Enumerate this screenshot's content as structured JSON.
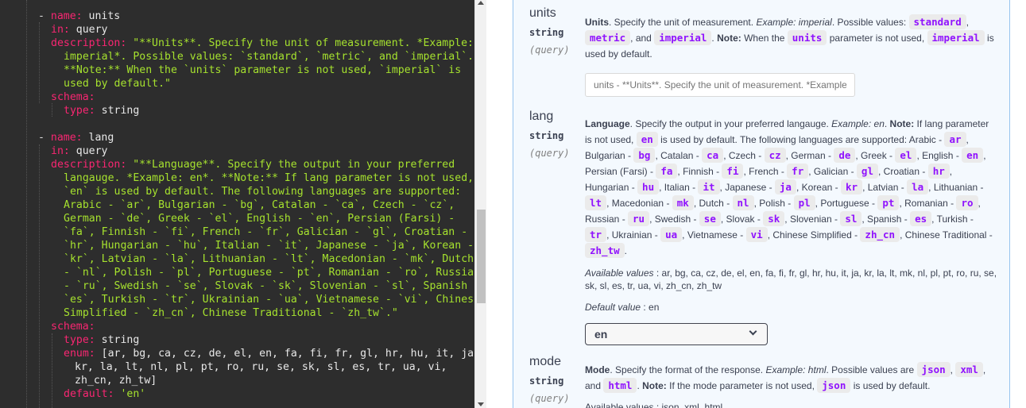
{
  "editor": {
    "lines": [
      [
        [
          "k-dash",
          "- "
        ],
        [
          "k-key",
          "name:"
        ],
        [
          "k-val",
          " units"
        ]
      ],
      [
        [
          "k-key",
          "in:"
        ],
        [
          "k-val",
          " query"
        ]
      ],
      [
        [
          "k-key",
          "description:"
        ],
        [
          "k-str",
          " \"**Units**. Specify the unit of measurement. *Example:"
        ]
      ],
      [
        [
          "k-str",
          "imperial*. Possible values: `standard`, `metric`, and `imperial`."
        ]
      ],
      [
        [
          "k-str",
          "**Note:** When the `units` parameter is not used, `imperial` is"
        ]
      ],
      [
        [
          "k-str",
          "used by default.\""
        ]
      ],
      [
        [
          "k-key",
          "schema:"
        ]
      ],
      [
        [
          "k-key",
          "type:"
        ],
        [
          "k-val",
          " string"
        ]
      ],
      [],
      [
        [
          "k-dash",
          "- "
        ],
        [
          "k-key",
          "name:"
        ],
        [
          "k-val",
          " lang"
        ]
      ],
      [
        [
          "k-key",
          "in:"
        ],
        [
          "k-val",
          " query"
        ]
      ],
      [
        [
          "k-key",
          "description:"
        ],
        [
          "k-str",
          " \"**Language**. Specify the output in your preferred"
        ]
      ],
      [
        [
          "k-str",
          "langauge. *Example: en*. **Note:** If lang parameter is not used,"
        ]
      ],
      [
        [
          "k-str",
          "`en` is used by default. The following languages are supported:"
        ]
      ],
      [
        [
          "k-str",
          "Arabic - `ar`, Bulgarian - `bg`, Catalan - `ca`, Czech - `cz`,"
        ]
      ],
      [
        [
          "k-str",
          "German - `de`, Greek - `el`, English - `en`, Persian (Farsi) -"
        ]
      ],
      [
        [
          "k-str",
          "`fa`, Finnish - `fi`, French - `fr`, Galician - `gl`, Croatian -"
        ]
      ],
      [
        [
          "k-str",
          "`hr`, Hungarian - `hu`, Italian - `it`, Japanese - `ja`, Korean -"
        ]
      ],
      [
        [
          "k-str",
          "`kr`, Latvian - `la`, Lithuanian - `lt`, Macedonian - `mk`, Dutch"
        ]
      ],
      [
        [
          "k-str",
          "- `nl`, Polish - `pl`, Portuguese - `pt`, Romanian - `ro`, Russian"
        ]
      ],
      [
        [
          "k-str",
          "- `ru`, Swedish - `se`, Slovak - `sk`, Slovenian - `sl`, Spanish -"
        ]
      ],
      [
        [
          "k-str",
          "`es`, Turkish - `tr`, Ukrainian - `ua`, Vietnamese - `vi`, Chinese"
        ]
      ],
      [
        [
          "k-str",
          "Simplified - `zh_cn`, Chinese Traditional - `zh_tw`.\""
        ]
      ],
      [
        [
          "k-key",
          "schema:"
        ]
      ],
      [
        [
          "k-key",
          "type:"
        ],
        [
          "k-val",
          " string"
        ]
      ],
      [
        [
          "k-key",
          "enum:"
        ],
        [
          "k-arr",
          " [ar, bg, ca, cz, de, el, en, fa, fi, fr, gl, hr, hu, it, ja,"
        ]
      ],
      [
        [
          "k-arr",
          "kr, la, lt, nl, pl, pt, ro, ru, se, sk, sl, es, tr, ua, vi,"
        ]
      ],
      [
        [
          "k-arr",
          "zh_cn, zh_tw]"
        ]
      ],
      [
        [
          "k-key",
          "default:"
        ],
        [
          "k-str",
          " 'en'"
        ]
      ]
    ]
  },
  "params": {
    "units": {
      "name": "units",
      "type": "string",
      "in": "(query)",
      "desc": [
        [
          "b",
          "Units"
        ],
        [
          "t",
          ". Specify the unit of measurement. "
        ],
        [
          "i",
          "Example: imperial"
        ],
        [
          "t",
          ". Possible values: "
        ],
        [
          "c",
          "standard"
        ],
        [
          "t",
          ", "
        ],
        [
          "c",
          "metric"
        ],
        [
          "t",
          ", and "
        ],
        [
          "c",
          "imperial"
        ],
        [
          "t",
          ". "
        ],
        [
          "b",
          "Note:"
        ],
        [
          "t",
          " When the "
        ],
        [
          "c",
          "units"
        ],
        [
          "t",
          " parameter is not used, "
        ],
        [
          "c",
          "imperial"
        ],
        [
          "t",
          " is used by default."
        ]
      ],
      "input_placeholder": "units - **Units**. Specify the unit of measurement. *Example:"
    },
    "lang": {
      "name": "lang",
      "type": "string",
      "in": "(query)",
      "desc": [
        [
          "b",
          "Language"
        ],
        [
          "t",
          ". Specify the output in your preferred langauge. "
        ],
        [
          "i",
          "Example: en"
        ],
        [
          "t",
          ". "
        ],
        [
          "b",
          "Note:"
        ],
        [
          "t",
          " If lang parameter is not used, "
        ],
        [
          "c",
          "en"
        ],
        [
          "t",
          " is used by default. The following languages are supported: Arabic - "
        ],
        [
          "c",
          "ar"
        ],
        [
          "t",
          ", Bulgarian - "
        ],
        [
          "c",
          "bg"
        ],
        [
          "t",
          ", Catalan - "
        ],
        [
          "c",
          "ca"
        ],
        [
          "t",
          ", Czech - "
        ],
        [
          "c",
          "cz"
        ],
        [
          "t",
          ", German - "
        ],
        [
          "c",
          "de"
        ],
        [
          "t",
          ", Greek - "
        ],
        [
          "c",
          "el"
        ],
        [
          "t",
          ", English - "
        ],
        [
          "c",
          "en"
        ],
        [
          "t",
          ", Persian (Farsi) - "
        ],
        [
          "c",
          "fa"
        ],
        [
          "t",
          ", Finnish - "
        ],
        [
          "c",
          "fi"
        ],
        [
          "t",
          ", French - "
        ],
        [
          "c",
          "fr"
        ],
        [
          "t",
          ", Galician - "
        ],
        [
          "c",
          "gl"
        ],
        [
          "t",
          ", Croatian - "
        ],
        [
          "c",
          "hr"
        ],
        [
          "t",
          ", Hungarian - "
        ],
        [
          "c",
          "hu"
        ],
        [
          "t",
          ", Italian - "
        ],
        [
          "c",
          "it"
        ],
        [
          "t",
          ", Japanese - "
        ],
        [
          "c",
          "ja"
        ],
        [
          "t",
          ", Korean - "
        ],
        [
          "c",
          "kr"
        ],
        [
          "t",
          ", Latvian - "
        ],
        [
          "c",
          "la"
        ],
        [
          "t",
          ", Lithuanian - "
        ],
        [
          "c",
          "lt"
        ],
        [
          "t",
          ", Macedonian - "
        ],
        [
          "c",
          "mk"
        ],
        [
          "t",
          ", Dutch - "
        ],
        [
          "c",
          "nl"
        ],
        [
          "t",
          ", Polish - "
        ],
        [
          "c",
          "pl"
        ],
        [
          "t",
          ", Portuguese - "
        ],
        [
          "c",
          "pt"
        ],
        [
          "t",
          ", Romanian - "
        ],
        [
          "c",
          "ro"
        ],
        [
          "t",
          ", Russian - "
        ],
        [
          "c",
          "ru"
        ],
        [
          "t",
          ", Swedish - "
        ],
        [
          "c",
          "se"
        ],
        [
          "t",
          ", Slovak - "
        ],
        [
          "c",
          "sk"
        ],
        [
          "t",
          ", Slovenian - "
        ],
        [
          "c",
          "sl"
        ],
        [
          "t",
          ", Spanish - "
        ],
        [
          "c",
          "es"
        ],
        [
          "t",
          ", Turkish - "
        ],
        [
          "c",
          "tr"
        ],
        [
          "t",
          ", Ukrainian - "
        ],
        [
          "c",
          "ua"
        ],
        [
          "t",
          ", Vietnamese - "
        ],
        [
          "c",
          "vi"
        ],
        [
          "t",
          ", Chinese Simplified - "
        ],
        [
          "c",
          "zh_cn"
        ],
        [
          "t",
          ", Chinese Traditional - "
        ],
        [
          "c",
          "zh_tw"
        ],
        [
          "t",
          "."
        ]
      ],
      "available_label": "Available values",
      "available_values": ": ar, bg, ca, cz, de, el, en, fa, fi, fr, gl, hr, hu, it, ja, kr, la, lt, mk, nl, pl, pt, ro, ru, se, sk, sl, es, tr, ua, vi, zh_cn, zh_tw",
      "default_label": "Default value",
      "default_value": ": en",
      "selected": "en"
    },
    "mode": {
      "name": "mode",
      "type": "string",
      "in": "(query)",
      "desc": [
        [
          "b",
          "Mode"
        ],
        [
          "t",
          ". Specify the format of the response. "
        ],
        [
          "i",
          "Example: html"
        ],
        [
          "t",
          ". Possible values are "
        ],
        [
          "c",
          "json"
        ],
        [
          "t",
          ", "
        ],
        [
          "c",
          "xml"
        ],
        [
          "t",
          ","
        ],
        [
          "t",
          " and "
        ],
        [
          "c",
          "html"
        ],
        [
          "t",
          ". "
        ],
        [
          "b",
          "Note:"
        ],
        [
          "t",
          " If the mode parameter is not used, "
        ],
        [
          "c",
          "json"
        ],
        [
          "t",
          " is used by default."
        ]
      ],
      "cut_text": "Available values : json, xml, html"
    }
  }
}
